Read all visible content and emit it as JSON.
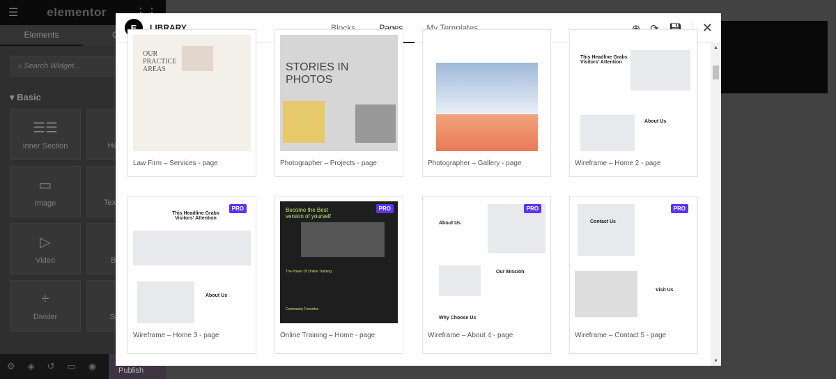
{
  "editor": {
    "logo": "elementor",
    "tabs": [
      "Elements",
      "Global"
    ],
    "search_placeholder": "Search Widget...",
    "category": "Basic",
    "widgets": [
      "Inner Section",
      "Heading",
      "Image",
      "Text Editor",
      "Video",
      "Button",
      "Divider",
      "Spacer"
    ],
    "publish": "Publish"
  },
  "library": {
    "title": "LIBRARY",
    "tabs": [
      "Blocks",
      "Pages",
      "My Templates"
    ],
    "active_tab": "Pages",
    "pro_badge": "PRO",
    "templates": [
      {
        "name": "Law Firm – Services - page",
        "thumb_text": [
          "OUR PRACTICE AREAS"
        ]
      },
      {
        "name": "Photographer – Projects - page",
        "thumb_text": [
          "STORIES IN PHOTOS"
        ]
      },
      {
        "name": "Photographer – Gallery - page",
        "thumb_text": []
      },
      {
        "name": "Wireframe – Home 2 - page",
        "thumb_text": [
          "This Headline Grabs Visitors' Attention",
          "About Us"
        ]
      },
      {
        "name": "Wireframe – Home 3 - page",
        "pro": true,
        "thumb_text": [
          "This Headline Grabs Visitors' Attention",
          "About Us"
        ]
      },
      {
        "name": "Online Training – Home - page",
        "pro": true,
        "thumb_text": [
          "Become the Best version of yourself",
          "The Power Of Online Training",
          "Community Favorites"
        ]
      },
      {
        "name": "Wireframe – About 4 - page",
        "pro": true,
        "thumb_text": [
          "About Us",
          "Our Mission",
          "Why Choose Us"
        ]
      },
      {
        "name": "Wireframe – Contact 5 - page",
        "pro": true,
        "thumb_text": [
          "Contact Us",
          "Visit Us"
        ]
      }
    ]
  },
  "colors": {
    "pro": "#5c32f7",
    "accent_green": "#c5e86c"
  }
}
